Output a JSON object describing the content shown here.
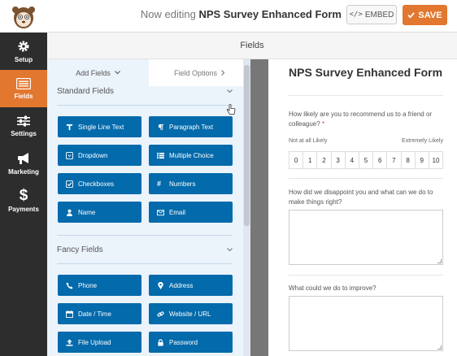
{
  "header": {
    "editing_prefix": "Now editing",
    "form_title": "NPS Survey Enhanced Form",
    "embed_label": "EMBED",
    "embed_icon": "code-icon",
    "save_label": "SAVE",
    "save_icon": "checkmark-icon"
  },
  "sidebar": {
    "items": [
      {
        "label": "Setup",
        "icon": "gear-icon",
        "active": false
      },
      {
        "label": "Fields",
        "icon": "list-icon",
        "active": true
      },
      {
        "label": "Settings",
        "icon": "sliders-icon",
        "active": false
      },
      {
        "label": "Marketing",
        "icon": "megaphone-icon",
        "active": false
      },
      {
        "label": "Payments",
        "icon": "dollar-icon",
        "active": false
      }
    ]
  },
  "fields_header": "Fields",
  "panel": {
    "tabs": [
      {
        "label": "Add Fields",
        "icon": "chevron-down-icon"
      },
      {
        "label": "Field Options",
        "icon": "chevron-right-icon"
      }
    ],
    "standard": {
      "title": "Standard Fields",
      "fields": [
        {
          "label": "Single Line Text",
          "icon": "text-icon"
        },
        {
          "label": "Paragraph Text",
          "icon": "paragraph-icon"
        },
        {
          "label": "Dropdown",
          "icon": "dropdown-icon"
        },
        {
          "label": "Multiple Choice",
          "icon": "list-icon"
        },
        {
          "label": "Checkboxes",
          "icon": "checkbox-icon"
        },
        {
          "label": "Numbers",
          "icon": "hash-icon"
        },
        {
          "label": "Name",
          "icon": "user-icon"
        },
        {
          "label": "Email",
          "icon": "envelope-icon"
        }
      ]
    },
    "fancy": {
      "title": "Fancy Fields",
      "fields": [
        {
          "label": "Phone",
          "icon": "phone-icon"
        },
        {
          "label": "Address",
          "icon": "map-marker-icon"
        },
        {
          "label": "Date / Time",
          "icon": "calendar-icon"
        },
        {
          "label": "Website / URL",
          "icon": "link-icon"
        },
        {
          "label": "File Upload",
          "icon": "upload-icon"
        },
        {
          "label": "Password",
          "icon": "lock-icon"
        }
      ]
    }
  },
  "preview": {
    "title": "NPS Survey Enhanced Form",
    "q1": "How likely are you to recommend us to a friend or colleague?",
    "q1_required": "*",
    "low_label": "Not at all Likely",
    "high_label": "Extremely Likely",
    "scale": [
      "0",
      "1",
      "2",
      "3",
      "4",
      "5",
      "6",
      "7",
      "8",
      "9",
      "10"
    ],
    "q2": "How did we disappoint you and what can we do to make things right?",
    "q3": "What could we do to improve?"
  },
  "colors": {
    "accent": "#e27730",
    "field_button": "#036aab",
    "sidebar": "#2d2d2d",
    "panel": "#ebf3fb"
  }
}
